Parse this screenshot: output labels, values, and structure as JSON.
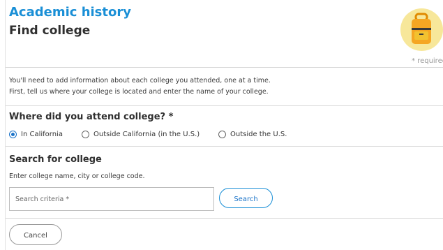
{
  "header": {
    "section_title": "Academic history",
    "page_title": "Find college",
    "required_note": "* required"
  },
  "intro": {
    "line1": "You'll need to add information about each college you attended, one at a time.",
    "line2": "First, tell us where your college is located and enter the name of your college."
  },
  "location_question": {
    "title": "Where did you attend college? *",
    "options": [
      {
        "label": "In California",
        "selected": true
      },
      {
        "label": "Outside California (in the U.S.)",
        "selected": false
      },
      {
        "label": "Outside the U.S.",
        "selected": false
      }
    ]
  },
  "search": {
    "title": "Search for college",
    "help": "Enter college name, city or college code.",
    "placeholder": "Search criteria *",
    "value": "",
    "button_label": "Search"
  },
  "actions": {
    "cancel_label": "Cancel"
  },
  "colors": {
    "accent": "#1a8fd6",
    "radio_selected": "#1a73c8",
    "avatar_bg": "#f7e79a",
    "backpack": "#f5a623"
  },
  "icons": {
    "avatar": "backpack-icon"
  }
}
